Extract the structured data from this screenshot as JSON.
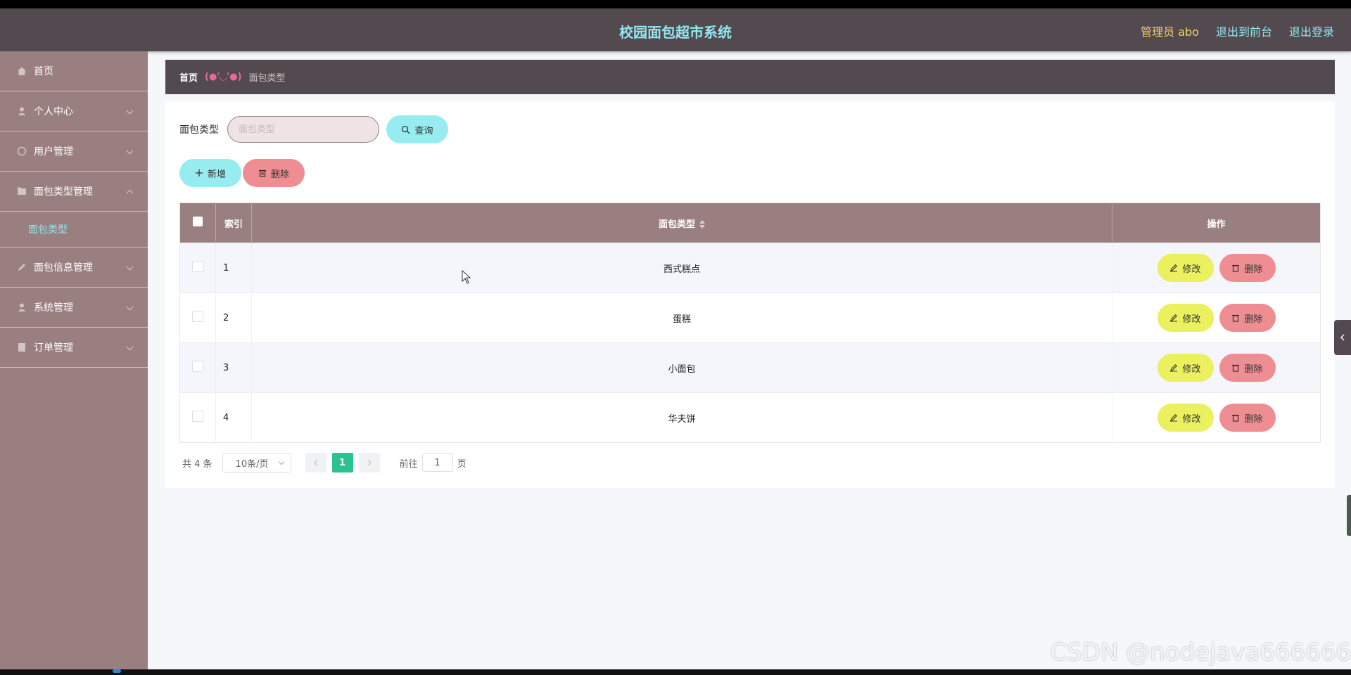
{
  "header": {
    "title": "校园面包超市系统",
    "admin_label": "管理员 abo",
    "to_frontend": "退出到前台",
    "logout": "退出登录"
  },
  "sidebar": {
    "items": [
      {
        "label": "首页",
        "icon": "home-icon"
      },
      {
        "label": "个人中心",
        "icon": "user-icon"
      },
      {
        "label": "用户管理",
        "icon": "user-group-icon"
      },
      {
        "label": "面包类型管理",
        "icon": "folder-icon"
      },
      {
        "label": "面包信息管理",
        "icon": "edit-icon"
      },
      {
        "label": "系统管理",
        "icon": "settings-icon"
      },
      {
        "label": "订单管理",
        "icon": "document-icon"
      }
    ],
    "active_sub": "面包类型"
  },
  "breadcrumb": {
    "home": "首页",
    "separator": "(●'◡'●)",
    "current": "面包类型"
  },
  "search": {
    "label": "面包类型",
    "placeholder": "面包类型",
    "query_button": "查询"
  },
  "actions": {
    "add_button": "新增",
    "delete_button": "删除"
  },
  "table": {
    "columns": {
      "index": "索引",
      "type": "面包类型",
      "ops": "操作"
    },
    "rows": [
      {
        "index": "1",
        "type": "西式糕点"
      },
      {
        "index": "2",
        "type": "蛋糕"
      },
      {
        "index": "3",
        "type": "小面包"
      },
      {
        "index": "4",
        "type": "华夫饼"
      }
    ],
    "edit_label": "修改",
    "delete_label": "删除"
  },
  "pagination": {
    "total": "共 4 条",
    "page_size": "10条/页",
    "current_page": "1",
    "goto_label": "前往",
    "goto_value": "1",
    "goto_suffix": "页"
  },
  "watermark": "CSDN @nodejava666666",
  "colors": {
    "header_bg": "#524a4e",
    "sidebar_bg": "#9a7f80",
    "accent_cyan": "#97ecef",
    "accent_pink": "#ef8e92",
    "accent_yellow": "#ebf05e",
    "active_page": "#2bc28f"
  }
}
